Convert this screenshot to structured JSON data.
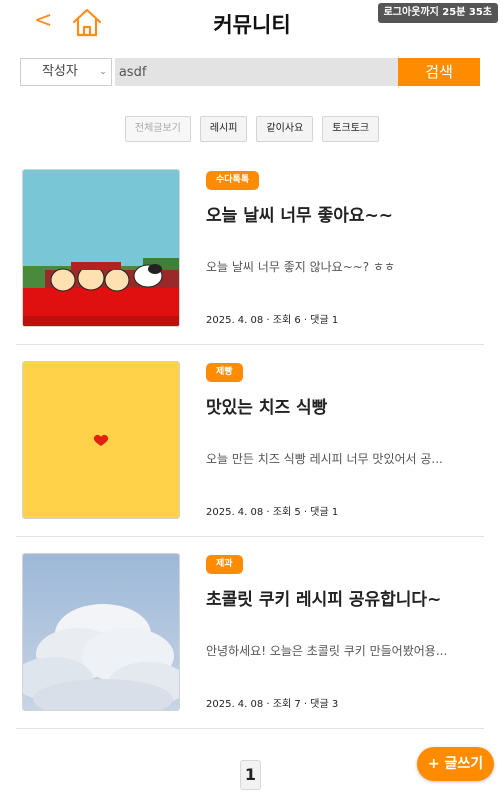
{
  "header": {
    "back_label": "<",
    "title": "커뮤니티",
    "logout_timer": "로그아웃까지 25분 35초",
    "home_icon": "home-icon",
    "accent_color": "#ff8c00"
  },
  "search": {
    "field_selected": "작성자",
    "value": "asdf",
    "button_label": "검색"
  },
  "tabs": [
    {
      "label": "전체글보기",
      "active": true
    },
    {
      "label": "레시피",
      "active": false
    },
    {
      "label": "같이사요",
      "active": false
    },
    {
      "label": "토크토크",
      "active": false
    }
  ],
  "posts": [
    {
      "category": "수다톡톡",
      "title": "오늘 날씨 너무 좋아요~~",
      "excerpt": "오늘 날씨 너무 좋지 않나요~~? ㅎㅎ",
      "meta": "2025. 4. 08 · 조회 6 · 댓글 1"
    },
    {
      "category": "제빵",
      "title": "맛있는 치즈 식빵",
      "excerpt": "오늘 만든 치즈 식빵 레시피 너무 맛있어서 공...",
      "meta": "2025. 4. 08 · 조회 5 · 댓글 1"
    },
    {
      "category": "제과",
      "title": "초콜릿 쿠키 레시피 공유합니다~",
      "excerpt": "안녕하세요! 오늘은 초콜릿 쿠키 만들어봤어용...",
      "meta": "2025. 4. 08 · 조회 7 · 댓글 3"
    }
  ],
  "pagination": {
    "current_page": "1"
  },
  "write_button_label": "+ 글쓰기"
}
